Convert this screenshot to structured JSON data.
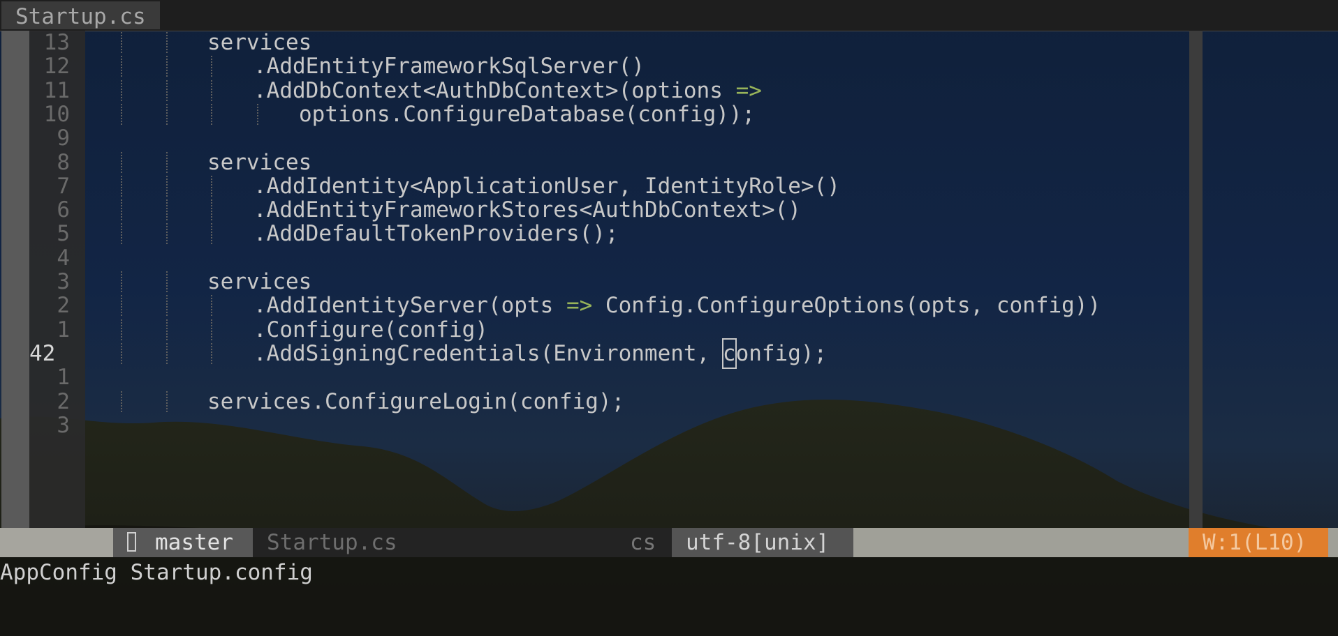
{
  "tab": {
    "label": "Startup.cs"
  },
  "editor": {
    "lines": [
      {
        "num": "13",
        "indent": 2,
        "text": "services"
      },
      {
        "num": "12",
        "indent": 3,
        "text": ".AddEntityFrameworkSqlServer()"
      },
      {
        "num": "11",
        "indent": 3,
        "text": ".AddDbContext<AuthDbContext>(options ",
        "arrow": "=>"
      },
      {
        "num": "10",
        "indent": 4,
        "text": "options.ConfigureDatabase(config));"
      },
      {
        "num": "9",
        "indent": 0,
        "text": ""
      },
      {
        "num": "8",
        "indent": 2,
        "text": "services"
      },
      {
        "num": "7",
        "indent": 3,
        "text": ".AddIdentity<ApplicationUser, IdentityRole>()"
      },
      {
        "num": "6",
        "indent": 3,
        "text": ".AddEntityFrameworkStores<AuthDbContext>()"
      },
      {
        "num": "5",
        "indent": 3,
        "text": ".AddDefaultTokenProviders();"
      },
      {
        "num": "4",
        "indent": 0,
        "text": ""
      },
      {
        "num": "3",
        "indent": 2,
        "text": "services"
      },
      {
        "num": "2",
        "indent": 3,
        "text": ".AddIdentityServer(opts ",
        "arrow": "=>",
        "after": " Config.ConfigureOptions(opts, config))"
      },
      {
        "num": "1",
        "indent": 3,
        "text": ".Configure(config)"
      },
      {
        "num": "42",
        "indent": 3,
        "current": true,
        "text": ".AddSigningCredentials(Environment, ",
        "cursor_char": "c",
        "after": "onfig);"
      },
      {
        "num": "1",
        "indent": 0,
        "text": ""
      },
      {
        "num": "2",
        "indent": 2,
        "text": "services.ConfigureLogin(config);"
      },
      {
        "num": "3",
        "indent": 0,
        "text": ""
      }
    ]
  },
  "statusline": {
    "branch_icon": "git-branch-icon",
    "branch": "master",
    "file": "Startup.cs",
    "filetype": "cs",
    "encoding": "utf-8[unix]",
    "warning": "W:1(L10)"
  },
  "cmdline": {
    "text": "AppConfig Startup.config"
  },
  "colors": {
    "arrow": "#98b45a",
    "warning_bg": "#e07e2c",
    "statusline_fill": "#a0a098"
  }
}
